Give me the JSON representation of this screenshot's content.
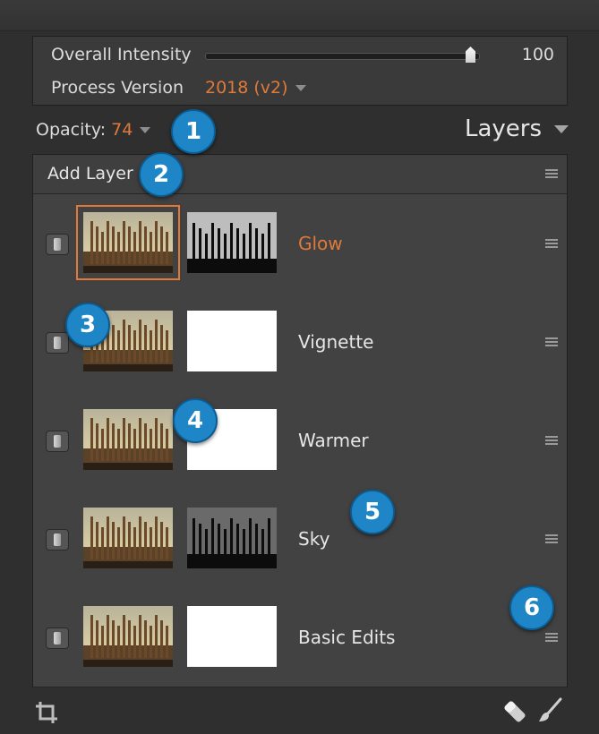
{
  "settings": {
    "intensity_label": "Overall Intensity",
    "intensity_value": "100",
    "intensity_level": 1.0,
    "process_label": "Process Version",
    "process_value": "2018 (v2)"
  },
  "opacity": {
    "label": "Opacity:",
    "value": "74"
  },
  "panel_title": "Layers",
  "add_layer_label": "Add Layer",
  "layers": [
    {
      "name": "Glow",
      "active": true,
      "mask": "dark"
    },
    {
      "name": "Vignette",
      "active": false,
      "mask": "white"
    },
    {
      "name": "Warmer",
      "active": false,
      "mask": "white"
    },
    {
      "name": "Sky",
      "active": false,
      "mask": "grey"
    },
    {
      "name": "Basic Edits",
      "active": false,
      "mask": "white"
    }
  ],
  "callouts": [
    "1",
    "2",
    "3",
    "4",
    "5",
    "6"
  ],
  "colors": {
    "accent": "#e07a3a",
    "callout": "#1e86c6"
  },
  "icons": {
    "crop": "crop-icon",
    "eraser": "eraser-icon",
    "brush": "brush-icon"
  }
}
